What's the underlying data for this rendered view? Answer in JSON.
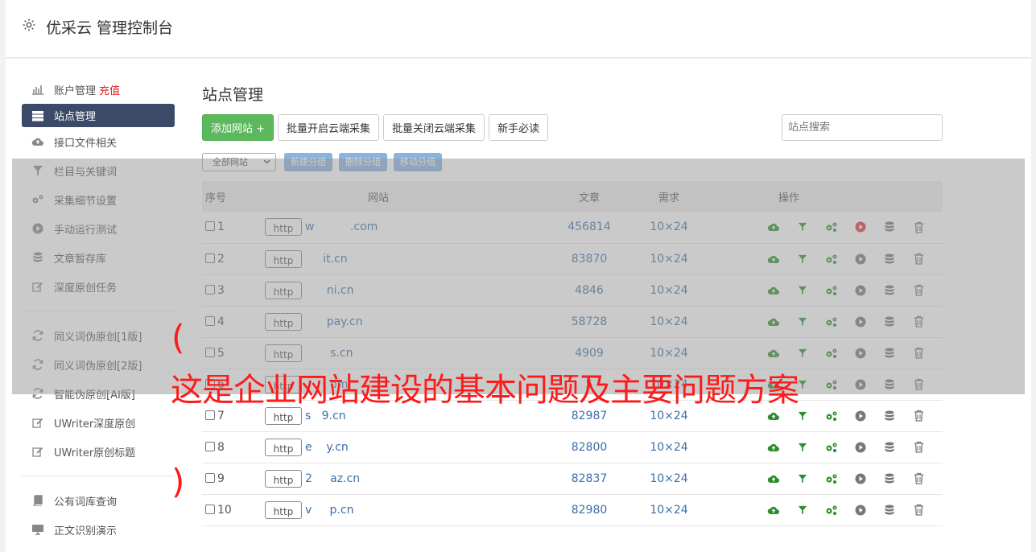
{
  "header": {
    "title": "优采云 管理控制台"
  },
  "sidebar": {
    "items": [
      {
        "label": "账户管理",
        "extra": "充值",
        "icon": "bar-chart-icon"
      },
      {
        "label": "站点管理",
        "icon": "server-icon",
        "active": true
      },
      {
        "label": "接口文件相关",
        "icon": "cloud-upload-icon"
      },
      {
        "label": "栏目与关键词",
        "icon": "filter-icon"
      },
      {
        "label": "采集细节设置",
        "icon": "gears-icon"
      },
      {
        "label": "手动运行测试",
        "icon": "play-circle-icon"
      },
      {
        "label": "文章暂存库",
        "icon": "database-icon"
      },
      {
        "label": "深度原创任务",
        "icon": "edit-icon"
      }
    ],
    "items2": [
      {
        "label": "同义词伪原创[1版]",
        "icon": "refresh-icon"
      },
      {
        "label": "同义词伪原创[2版]",
        "icon": "refresh-icon"
      },
      {
        "label": "智能伪原创[AI版]",
        "icon": "refresh-icon"
      },
      {
        "label": "UWriter深度原创",
        "icon": "edit-icon"
      },
      {
        "label": "UWriter原创标题",
        "icon": "edit-icon"
      }
    ],
    "items3": [
      {
        "label": "公有词库查询",
        "icon": "book-icon"
      },
      {
        "label": "正文识别演示",
        "icon": "monitor-icon"
      }
    ]
  },
  "content": {
    "title": "站点管理",
    "toolbar": {
      "add": "添加网站 +",
      "batch_on": "批量开启云端采集",
      "batch_off": "批量关闭云端采集",
      "guide": "新手必读",
      "search_placeholder": "站点搜索"
    },
    "group": {
      "select": "全部网站",
      "new": "新建分组",
      "delete": "删除分组",
      "move": "移动分组"
    },
    "table": {
      "headers": {
        "idx": "序号",
        "site": "网站",
        "articles": "文章",
        "req": "需求",
        "ops": "操作"
      },
      "rows": [
        {
          "idx": "1",
          "proto": "http",
          "domain": "w          .com",
          "articles": "456814",
          "req": "10×24",
          "run_red": true
        },
        {
          "idx": "2",
          "proto": "http",
          "domain": "     it.cn",
          "articles": "83870",
          "req": "10×24"
        },
        {
          "idx": "3",
          "proto": "http",
          "domain": "      ni.cn",
          "articles": "4846",
          "req": "10×24"
        },
        {
          "idx": "4",
          "proto": "http",
          "domain": "      pay.cn",
          "articles": "58728",
          "req": "10×24"
        },
        {
          "idx": "5",
          "proto": "http",
          "domain": "       s.cn",
          "articles": "4909",
          "req": "10×24"
        },
        {
          "idx": "6",
          "proto": "http",
          "domain": "       om",
          "articles": "5   ",
          "req": "10×24"
        },
        {
          "idx": "7",
          "proto": "http",
          "domain": "s   9.cn",
          "articles": "82987",
          "req": "10×24"
        },
        {
          "idx": "8",
          "proto": "http",
          "domain": "e    y.cn",
          "articles": "82800",
          "req": "10×24"
        },
        {
          "idx": "9",
          "proto": "http",
          "domain": "2     az.cn",
          "articles": "82837",
          "req": "10×24"
        },
        {
          "idx": "10",
          "proto": "http",
          "domain": "v     p.cn",
          "articles": "82980",
          "req": "10×24"
        }
      ]
    }
  },
  "overlay": {
    "paren_open": "(",
    "caption": "这是企业网站建设的基本问题及主要问题方案",
    "paren_close": ")"
  },
  "colors": {
    "accent_green": "#5cb85c",
    "nav_active": "#3b4b67",
    "caption_red": "#ff1a1a",
    "op_green": "#2e8b2e",
    "op_red": "#e53030"
  }
}
